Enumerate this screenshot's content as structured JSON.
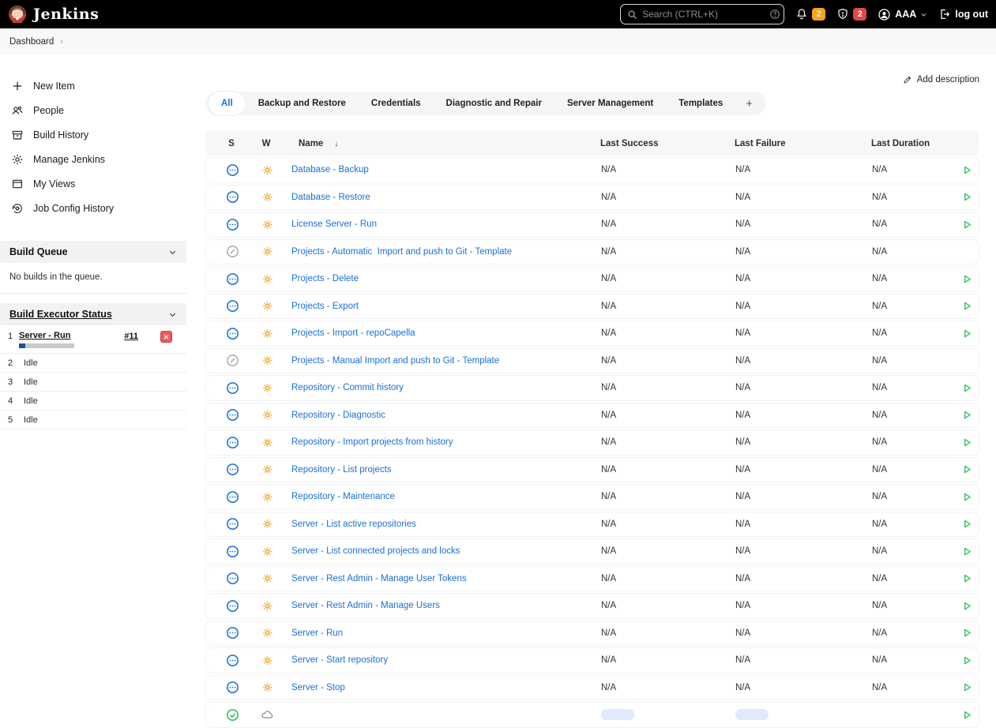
{
  "header": {
    "brand": "Jenkins",
    "search": {
      "placeholder": "Search (CTRL+K)"
    },
    "badges": {
      "notifications": "2",
      "security": "2"
    },
    "user": "AAA",
    "logout_label": "log out"
  },
  "breadcrumb": {
    "items": [
      "Dashboard"
    ]
  },
  "sidebar": {
    "nav_items": [
      {
        "label": "New Item",
        "icon": "plus-icon",
        "name": "sidebar-item-new-item"
      },
      {
        "label": "People",
        "icon": "people-icon",
        "name": "sidebar-item-people"
      },
      {
        "label": "Build History",
        "icon": "build-history-icon",
        "name": "sidebar-item-build-history"
      },
      {
        "label": "Manage Jenkins",
        "icon": "gear-icon",
        "name": "sidebar-item-manage-jenkins"
      },
      {
        "label": "My Views",
        "icon": "window-icon",
        "name": "sidebar-item-my-views"
      },
      {
        "label": "Job Config History",
        "icon": "config-history-icon",
        "name": "sidebar-item-job-config-history"
      }
    ],
    "build_queue": {
      "title": "Build Queue",
      "empty_text": "No builds in the queue."
    },
    "executor_status": {
      "title": "Build Executor Status",
      "executors": [
        {
          "number": "1",
          "label": "Server - Run",
          "build": "#11",
          "progress_percent": 11
        },
        {
          "number": "2",
          "label": "Idle"
        },
        {
          "number": "3",
          "label": "Idle"
        },
        {
          "number": "4",
          "label": "Idle"
        },
        {
          "number": "5",
          "label": "Idle"
        }
      ]
    }
  },
  "main": {
    "add_description_label": "Add description",
    "tabs": [
      "All",
      "Backup and Restore",
      "Credentials",
      "Diagnostic and Repair",
      "Server Management",
      "Templates"
    ],
    "active_tab": "All",
    "table": {
      "columns": [
        "S",
        "W",
        "Name",
        "Last Success",
        "Last Failure",
        "Last Duration"
      ],
      "sort_column": "Name",
      "sort_direction": "down",
      "rows": [
        {
          "name": "Database - Backup",
          "status": "pending",
          "weather": "sunny",
          "last_success": "N/A",
          "last_failure": "N/A",
          "last_duration": "N/A",
          "runnable": true
        },
        {
          "name": "Database - Restore",
          "status": "pending",
          "weather": "sunny",
          "last_success": "N/A",
          "last_failure": "N/A",
          "last_duration": "N/A",
          "runnable": true
        },
        {
          "name": "License Server - Run",
          "status": "pending",
          "weather": "sunny",
          "last_success": "N/A",
          "last_failure": "N/A",
          "last_duration": "N/A",
          "runnable": true
        },
        {
          "name": "Projects - Automatic  Import and push to Git - Template",
          "status": "disabled",
          "weather": "sunny",
          "last_success": "N/A",
          "last_failure": "N/A",
          "last_duration": "N/A",
          "runnable": false
        },
        {
          "name": "Projects - Delete",
          "status": "pending",
          "weather": "sunny",
          "last_success": "N/A",
          "last_failure": "N/A",
          "last_duration": "N/A",
          "runnable": true
        },
        {
          "name": "Projects - Export",
          "status": "pending",
          "weather": "sunny",
          "last_success": "N/A",
          "last_failure": "N/A",
          "last_duration": "N/A",
          "runnable": true
        },
        {
          "name": "Projects - Import - repoCapella",
          "status": "pending",
          "weather": "sunny",
          "last_success": "N/A",
          "last_failure": "N/A",
          "last_duration": "N/A",
          "runnable": true
        },
        {
          "name": "Projects - Manual Import and push to Git - Template",
          "status": "disabled",
          "weather": "sunny",
          "last_success": "N/A",
          "last_failure": "N/A",
          "last_duration": "N/A",
          "runnable": false
        },
        {
          "name": "Repository - Commit history",
          "status": "pending",
          "weather": "sunny",
          "last_success": "N/A",
          "last_failure": "N/A",
          "last_duration": "N/A",
          "runnable": true
        },
        {
          "name": "Repository - Diagnostic",
          "status": "pending",
          "weather": "sunny",
          "last_success": "N/A",
          "last_failure": "N/A",
          "last_duration": "N/A",
          "runnable": true
        },
        {
          "name": "Repository - Import projects from history",
          "status": "pending",
          "weather": "sunny",
          "last_success": "N/A",
          "last_failure": "N/A",
          "last_duration": "N/A",
          "runnable": true
        },
        {
          "name": "Repository - List projects",
          "status": "pending",
          "weather": "sunny",
          "last_success": "N/A",
          "last_failure": "N/A",
          "last_duration": "N/A",
          "runnable": true
        },
        {
          "name": "Repository - Maintenance",
          "status": "pending",
          "weather": "sunny",
          "last_success": "N/A",
          "last_failure": "N/A",
          "last_duration": "N/A",
          "runnable": true
        },
        {
          "name": "Server - List active repositories",
          "status": "pending",
          "weather": "sunny",
          "last_success": "N/A",
          "last_failure": "N/A",
          "last_duration": "N/A",
          "runnable": true
        },
        {
          "name": "Server - List connected projects and locks",
          "status": "pending",
          "weather": "sunny",
          "last_success": "N/A",
          "last_failure": "N/A",
          "last_duration": "N/A",
          "runnable": true
        },
        {
          "name": "Server - Rest Admin - Manage User Tokens",
          "status": "pending",
          "weather": "sunny",
          "last_success": "N/A",
          "last_failure": "N/A",
          "last_duration": "N/A",
          "runnable": true
        },
        {
          "name": "Server - Rest Admin - Manage Users",
          "status": "pending",
          "weather": "sunny",
          "last_success": "N/A",
          "last_failure": "N/A",
          "last_duration": "N/A",
          "runnable": true
        },
        {
          "name": "Server - Run",
          "status": "pending",
          "weather": "sunny",
          "last_success": "N/A",
          "last_failure": "N/A",
          "last_duration": "N/A",
          "runnable": true
        },
        {
          "name": "Server - Start repository",
          "status": "pending",
          "weather": "sunny",
          "last_success": "N/A",
          "last_failure": "N/A",
          "last_duration": "N/A",
          "runnable": true
        },
        {
          "name": "Server - Stop",
          "status": "pending",
          "weather": "sunny",
          "last_success": "N/A",
          "last_failure": "N/A",
          "last_duration": "N/A",
          "runnable": true
        },
        {
          "name": "",
          "status": "success",
          "weather": "cloudy",
          "skeleton": true,
          "runnable": true
        }
      ]
    }
  },
  "colors": {
    "accent_blue": "#1a6fd4",
    "success_green": "#2dbe60",
    "warning_orange": "#f9a21b",
    "danger_red": "#e64545",
    "sun_orange": "#f6a21c",
    "progress_blue": "#20538f"
  }
}
